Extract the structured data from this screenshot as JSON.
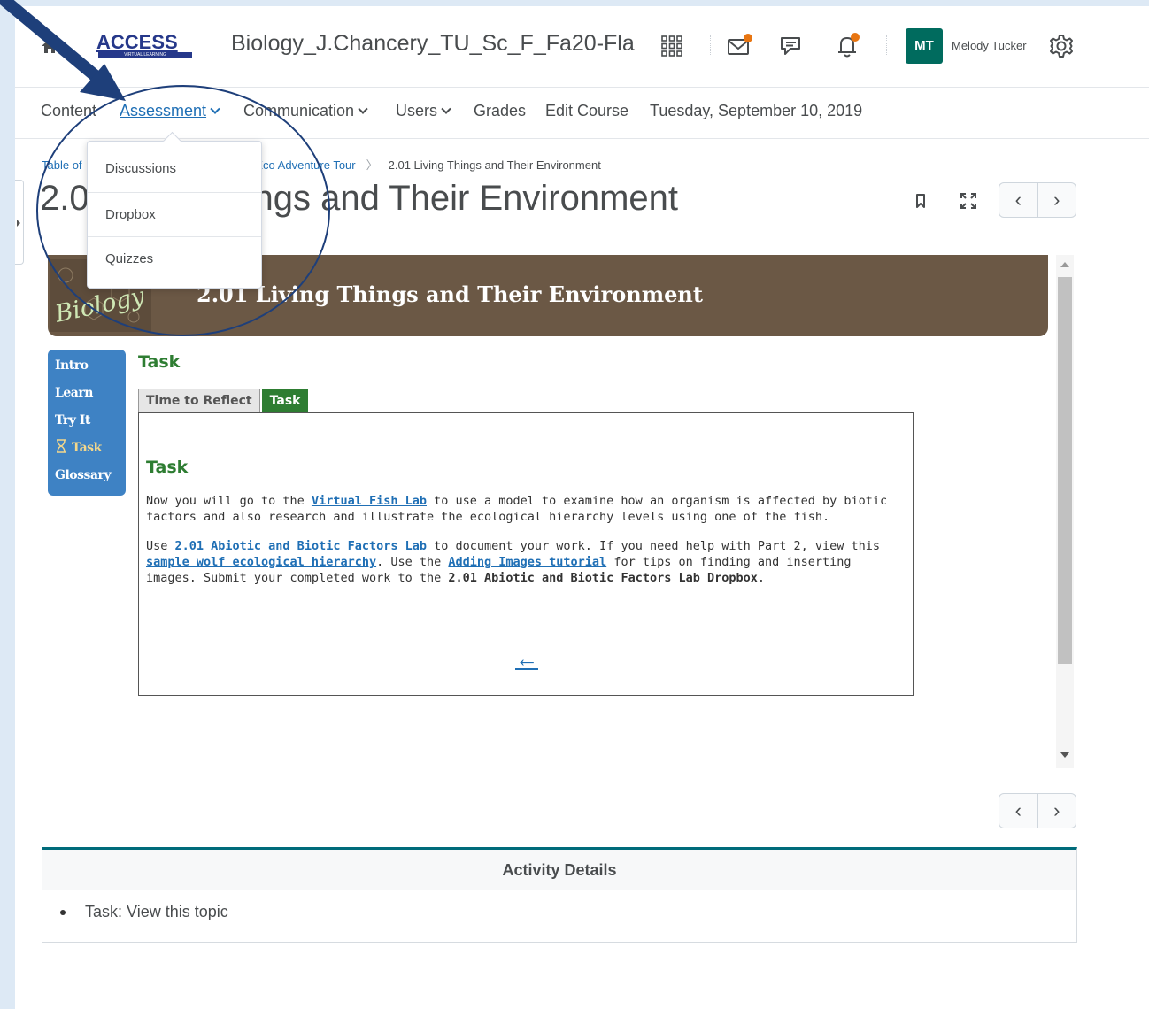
{
  "header": {
    "logo_text": "ACCESS",
    "logo_subtext": "VIRTUAL LEARNING",
    "course_title": "Biology_J.Chancery_TU_Sc_F_Fa20-Fla",
    "user_initials": "MT",
    "user_name": "Melody Tucker"
  },
  "nav": {
    "items": [
      {
        "label": "Content"
      },
      {
        "label": "Assessment"
      },
      {
        "label": "Communication"
      },
      {
        "label": "Users"
      },
      {
        "label": "Grades"
      },
      {
        "label": "Edit Course"
      },
      {
        "label": "Tuesday, September 10, 2019"
      }
    ]
  },
  "dropdown": {
    "items": [
      {
        "label": "Discussions"
      },
      {
        "label": "Dropbox"
      },
      {
        "label": "Quizzes"
      }
    ]
  },
  "breadcrumb": {
    "first": "Table of",
    "second": "e Eco Adventure Tour",
    "current": "2.01 Living Things and Their Environment"
  },
  "page": {
    "title_start": "2.0",
    "title_end": "ings and Their Environment"
  },
  "lesson": {
    "banner_logo": "Biology",
    "banner_title": "2.01 Living Things and Their Environment",
    "nav": [
      "Intro",
      "Learn",
      "Try It",
      "Task",
      "Glossary"
    ],
    "heading": "Task",
    "tabs": [
      "Time to Reflect",
      "Task"
    ],
    "box_heading": "Task",
    "p1": {
      "before": "Now you will go to the ",
      "link": "Virtual Fish Lab",
      "after": " to use a model to examine how an organism is affected by biotic factors and also research and illustrate the ecological hierarchy levels using one of the fish."
    },
    "p2": {
      "t1": "Use ",
      "link1": "2.01 Abiotic and Biotic Factors Lab",
      "t2": " to document your work. If you need help with Part 2, view this ",
      "link2": "sample wolf ecological hierarchy",
      "t3": ". Use the ",
      "link3": "Adding Images tutorial",
      "t4": " for tips on finding and inserting images. Submit your completed work to the ",
      "bold": "2.01 Abiotic and Biotic Factors Lab Dropbox",
      "t5": "."
    },
    "back_arrow": "←"
  },
  "pager": {
    "prev": "‹",
    "next": "›"
  },
  "activity": {
    "title": "Activity Details",
    "item": "Task: View this topic"
  },
  "colors": {
    "brand_blue": "#26388a",
    "link_blue": "#1f6fb5",
    "avatar_teal": "#006b5e",
    "banner_brown": "#6b5845",
    "lesson_nav_blue": "#3e82c4",
    "task_green": "#2e7d32",
    "callout_navy": "#1e3f7a",
    "notification_orange": "#e87511"
  },
  "icons": [
    "home-icon",
    "waffle-icon",
    "mail-icon",
    "chat-icon",
    "bell-icon",
    "gear-icon",
    "bookmark-icon",
    "fullscreen-icon",
    "hourglass-icon"
  ]
}
